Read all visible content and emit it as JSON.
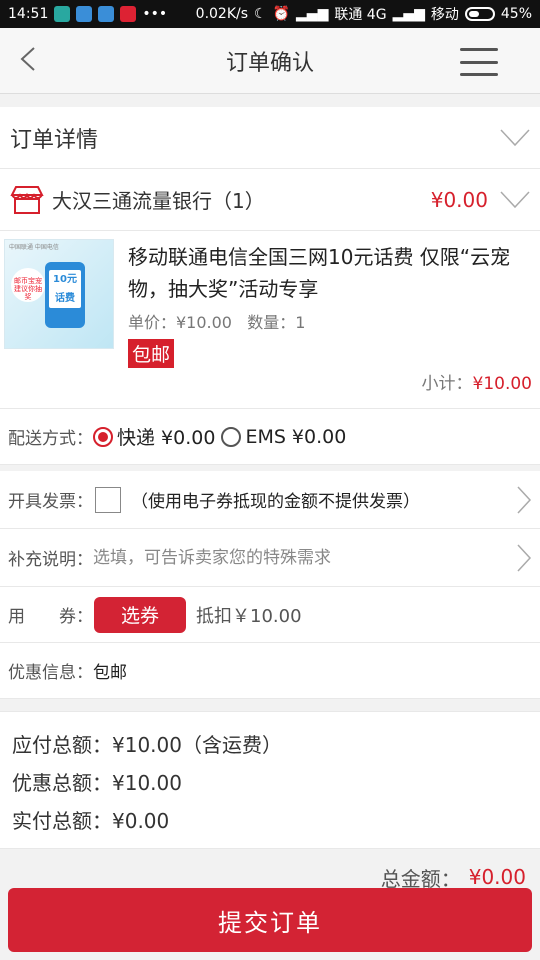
{
  "status_bar": {
    "time": "14:51",
    "net_speed": "0.02K/s",
    "carrier1": "联通 4G",
    "carrier2": "移动",
    "battery": "45%"
  },
  "header": {
    "title": "订单确认"
  },
  "order_detail": {
    "title": "订单详情"
  },
  "shop": {
    "name": "大汉三通流量银行（1）",
    "price": "¥0.00"
  },
  "product": {
    "name": "移动联通电信全国三网10元话费 仅限“云宠物，抽大奖”活动专享",
    "unit_price": "单价：¥10.00",
    "quantity": "数量：1",
    "tag": "包邮",
    "subtotal_label": "小计：",
    "subtotal_value": "¥10.00",
    "thumb_screen": "10元话费",
    "thumb_bubble": "邮币宝宠 建议你抽奖",
    "thumb_logos": "中国联通 中国电信"
  },
  "shipping": {
    "label": "配送方式：",
    "options": [
      {
        "label": "快递 ¥0.00",
        "selected": true
      },
      {
        "label": "EMS ¥0.00",
        "selected": false
      }
    ]
  },
  "invoice": {
    "label": "开具发票：",
    "note": "（使用电子券抵现的金额不提供发票）"
  },
  "remark": {
    "label": "补充说明：",
    "placeholder": "选填，可告诉卖家您的特殊需求"
  },
  "coupon": {
    "label": "用　　券：",
    "button": "选券",
    "deduct": "抵扣￥10.00"
  },
  "promo": {
    "label": "优惠信息：",
    "value": "包邮"
  },
  "totals": {
    "payable": "应付总额：¥10.00（含运费）",
    "discount": "优惠总额：¥10.00",
    "actual": "实付总额：¥0.00"
  },
  "grand_total": {
    "label": "总金额：",
    "value": "¥0.00"
  },
  "submit_label": "提交订单",
  "colors": {
    "accent": "#d6202c",
    "button": "#d32334"
  }
}
